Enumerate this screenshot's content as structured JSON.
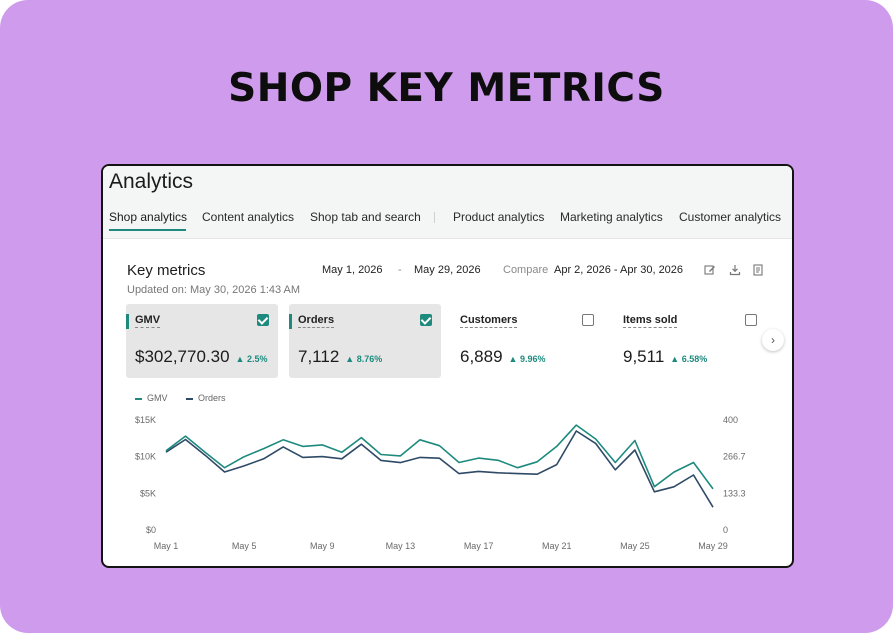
{
  "headline": "SHOP KEY METRICS",
  "app": {
    "title": "Analytics"
  },
  "tabs": [
    "Shop analytics",
    "Content analytics",
    "Shop tab and search",
    "Product analytics",
    "Marketing analytics",
    "Customer analytics"
  ],
  "key_metrics": {
    "title": "Key metrics",
    "updated": "Updated on: May 30, 2026 1:43 AM",
    "date_start": "May 1, 2026",
    "date_sep": "-",
    "date_end": "May 29, 2026",
    "compare_label": "Compare",
    "compare_range": "Apr 2, 2026 - Apr 30, 2026"
  },
  "icons": {
    "edit": "edit-icon",
    "download": "download-icon",
    "report": "report-icon",
    "next": "chevron-right-icon"
  },
  "cards": [
    {
      "label": "GMV",
      "value": "$302,770.30",
      "change": "▲ 2.5%",
      "selected": true
    },
    {
      "label": "Orders",
      "value": "7,112",
      "change": "▲ 8.76%",
      "selected": true
    },
    {
      "label": "Customers",
      "value": "6,889",
      "change": "▲ 9.96%",
      "selected": false
    },
    {
      "label": "Items sold",
      "value": "9,511",
      "change": "▲ 6.58%",
      "selected": false
    }
  ],
  "colors": {
    "accent": "#1e8a7e",
    "orders_line": "#2e4a66",
    "background": "#cf9bec"
  },
  "chart_data": {
    "type": "line",
    "x_ticks": [
      "May 1",
      "May 5",
      "May 9",
      "May 13",
      "May 17",
      "May 21",
      "May 25",
      "May 29"
    ],
    "x": [
      "May 1",
      "May 2",
      "May 3",
      "May 4",
      "May 5",
      "May 6",
      "May 7",
      "May 8",
      "May 9",
      "May 10",
      "May 11",
      "May 12",
      "May 13",
      "May 14",
      "May 15",
      "May 16",
      "May 17",
      "May 18",
      "May 19",
      "May 20",
      "May 21",
      "May 22",
      "May 23",
      "May 24",
      "May 25",
      "May 26",
      "May 27",
      "May 28",
      "May 29"
    ],
    "y_left_ticks": [
      "$0",
      "$5K",
      "$10K",
      "$15K"
    ],
    "y_right_ticks": [
      "0",
      "133.3",
      "266.7",
      "400"
    ],
    "ylim_left": [
      0,
      15000
    ],
    "ylim_right": [
      0,
      400
    ],
    "series": [
      {
        "name": "GMV",
        "axis": "left",
        "values": [
          10800,
          12800,
          10600,
          8500,
          10000,
          11100,
          12300,
          11400,
          11600,
          10600,
          12600,
          10300,
          10100,
          12300,
          11500,
          9200,
          9800,
          9500,
          8500,
          9300,
          11400,
          14300,
          12400,
          9200,
          12200,
          5900,
          7900,
          9200,
          5600
        ]
      },
      {
        "name": "Orders",
        "axis": "right",
        "values": [
          283,
          329,
          272,
          211,
          233,
          259,
          302,
          264,
          267,
          259,
          312,
          253,
          245,
          264,
          261,
          205,
          213,
          208,
          205,
          203,
          238,
          360,
          314,
          219,
          291,
          139,
          157,
          200,
          83
        ]
      }
    ],
    "legend": "top-left",
    "grid": false
  }
}
